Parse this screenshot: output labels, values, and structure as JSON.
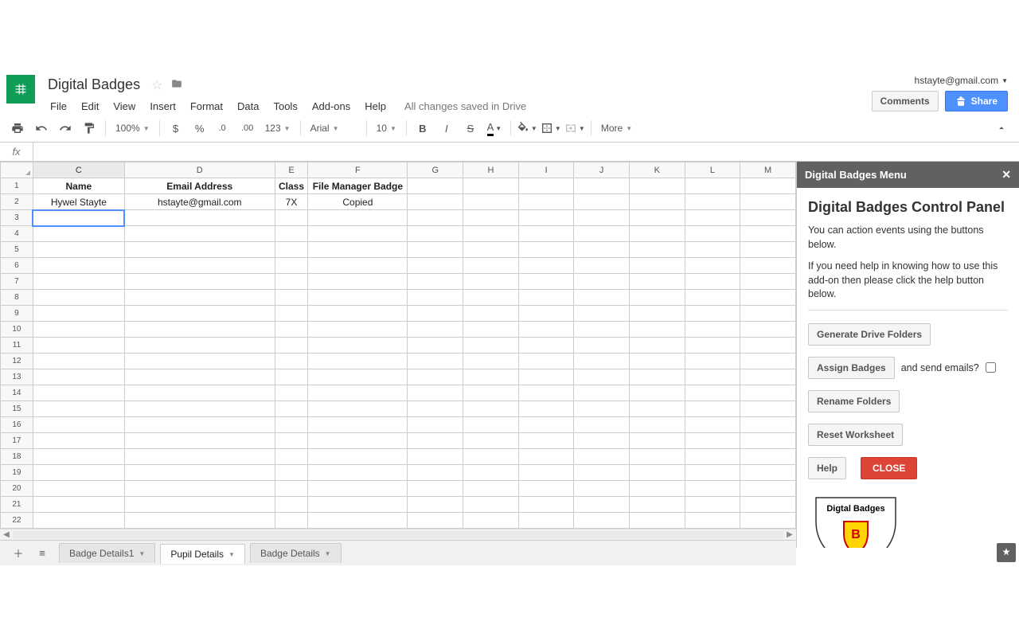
{
  "header": {
    "doc_title": "Digital Badges",
    "account_email": "hstayte@gmail.com",
    "comments_label": "Comments",
    "share_label": "Share",
    "save_status": "All changes saved in Drive"
  },
  "menu": [
    "File",
    "Edit",
    "View",
    "Insert",
    "Format",
    "Data",
    "Tools",
    "Add-ons",
    "Help"
  ],
  "toolbar": {
    "zoom": "100%",
    "number_format": "123",
    "font": "Arial",
    "font_size": "10",
    "more": "More"
  },
  "formula_bar": {
    "label": "fx",
    "value": ""
  },
  "sheet": {
    "visible_columns": [
      "C",
      "D",
      "E",
      "F",
      "G",
      "H",
      "I",
      "J",
      "K",
      "L",
      "M"
    ],
    "selected_column": "C",
    "row_count": 22,
    "active_cell": {
      "row": 3,
      "col": "C"
    },
    "headers": {
      "C": "Name",
      "D": "Email Address",
      "E": "Class",
      "F": "File Manager Badge"
    },
    "data_rows": [
      {
        "row": 2,
        "C": "Hywel Stayte",
        "D": "hstayte@gmail.com",
        "E": "7X",
        "F": "Copied"
      }
    ]
  },
  "tabs": {
    "items": [
      {
        "label": "Badge Details1",
        "active": false
      },
      {
        "label": "Pupil Details",
        "active": true
      },
      {
        "label": "Badge Details",
        "active": false
      }
    ]
  },
  "sidebar": {
    "title": "Digital Badges Menu",
    "heading": "Digital Badges Control Panel",
    "p1": "You can action events using the buttons below.",
    "p2": "If you need help in knowing how to use this add-on then please click the help button below.",
    "btn_generate": "Generate Drive Folders",
    "btn_assign": "Assign Badges",
    "and_send": "and send emails?",
    "btn_rename": "Rename Folders",
    "btn_reset": "Reset Worksheet",
    "btn_help": "Help",
    "btn_close": "CLOSE",
    "shield_text": "Digtal Badges",
    "shield_letter": "B"
  }
}
